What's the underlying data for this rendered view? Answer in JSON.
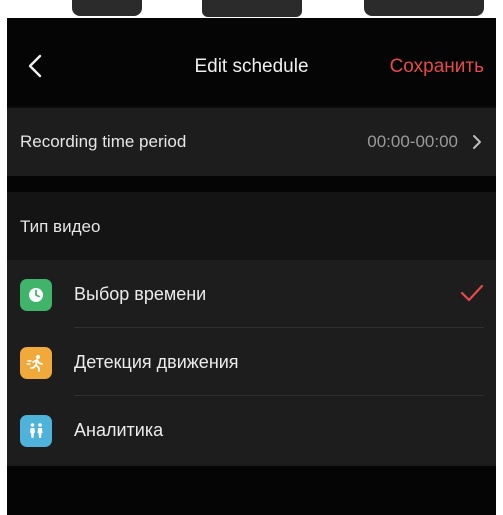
{
  "header": {
    "title": "Edit schedule",
    "save_label": "Сохранить"
  },
  "recording": {
    "label": "Recording time period",
    "value": "00:00-00:00"
  },
  "video_type": {
    "section_label": "Тип видео",
    "items": [
      {
        "label": "Выбор времени",
        "icon": "clock-icon",
        "color": "#3fb46a",
        "selected": true
      },
      {
        "label": "Детекция движения",
        "icon": "motion-runner-icon",
        "color": "#f0a93a",
        "selected": false
      },
      {
        "label": "Аналитика",
        "icon": "people-analytics-icon",
        "color": "#4fb2db",
        "selected": false
      }
    ]
  },
  "colors": {
    "accent": "#e64a4a",
    "background": "#050505",
    "row_background": "#1d1d1d"
  }
}
